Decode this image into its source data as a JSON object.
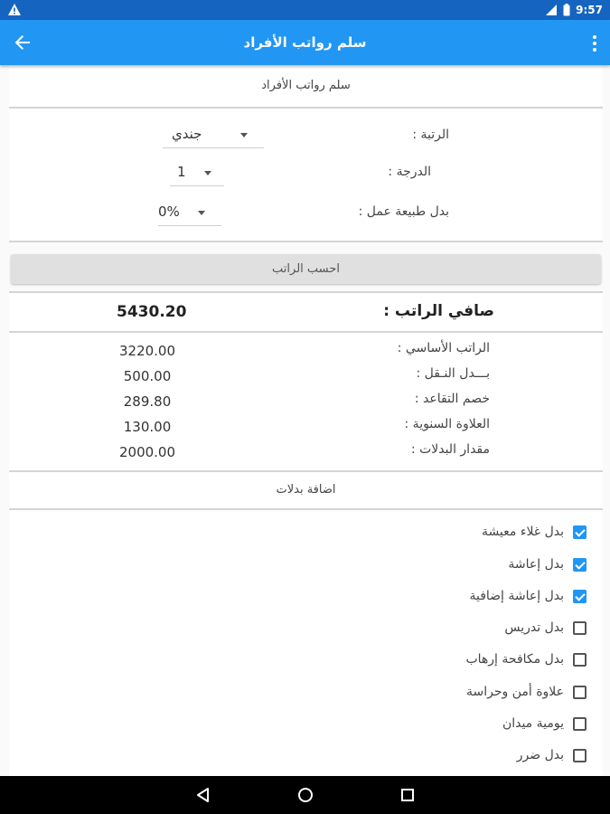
{
  "statusbar": {
    "time": "9:57"
  },
  "appbar": {
    "title": "سلم رواتب الأفراد"
  },
  "header": {
    "title": "سلم رواتب الأفراد"
  },
  "form": {
    "rank_label": "الرتبة :",
    "rank_value": "جندي",
    "grade_label": "الدرجة :",
    "grade_value": "1",
    "work_allowance_label": "بدل طبيعة عمل :",
    "work_allowance_value": "0%"
  },
  "calculate_button": "احسب الراتب",
  "net_salary": {
    "label": "صافي الراتب :",
    "value": "5430.20"
  },
  "breakdown": [
    {
      "label": "الراتب الأساسي :",
      "value": "3220.00"
    },
    {
      "label": "بـــدل النـقل :",
      "value": "500.00"
    },
    {
      "label": "خصم التقاعد :",
      "value": "289.80"
    },
    {
      "label": "العلاوة السنوية :",
      "value": "130.00"
    },
    {
      "label": "مقدار البدلات :",
      "value": "2000.00"
    }
  ],
  "allowances_header": "اضافة بدلات",
  "allowances": [
    {
      "label": "بدل غلاء معيشة",
      "checked": true
    },
    {
      "label": "بدل إعاشة",
      "checked": true
    },
    {
      "label": "بدل إعاشة إضافية",
      "checked": true
    },
    {
      "label": "بدل تدريس",
      "checked": false
    },
    {
      "label": "بدل مكافحة إرهاب",
      "checked": false
    },
    {
      "label": "علاوة أمن وحراسة",
      "checked": false
    },
    {
      "label": "يومية ميدان",
      "checked": false
    },
    {
      "label": "بدل ضرر",
      "checked": false
    }
  ],
  "colors": {
    "primary": "#2196f3",
    "statusbar": "#1565c0",
    "accent": "#2196f3"
  }
}
